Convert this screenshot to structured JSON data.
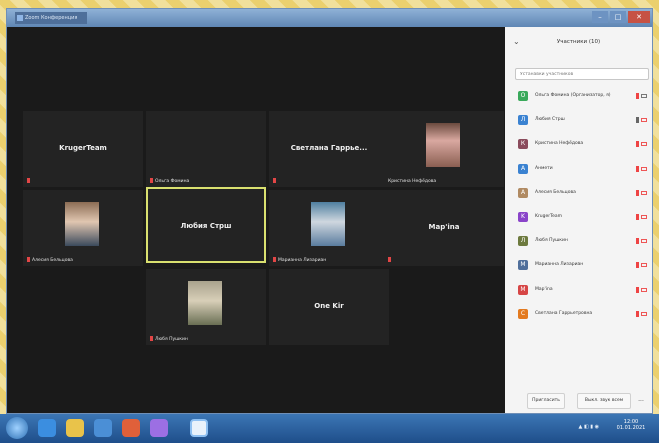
{
  "window": {
    "tab_title": "Zoom Конференция"
  },
  "gallery": {
    "tiles": [
      {
        "name": "KrugerTeam",
        "caption": ""
      },
      {
        "name": "",
        "caption": "Ольга Фомина"
      },
      {
        "name": "Светлана Гаррье...",
        "caption": ""
      },
      {
        "name": "",
        "caption": "Кристина Нефёдова"
      },
      {
        "name": "",
        "caption": "Алесия Бельцова"
      },
      {
        "name": "Любия Стрш",
        "caption": ""
      },
      {
        "name": "",
        "caption": "Марианна Лизариан"
      },
      {
        "name": "Мар'inа",
        "caption": ""
      },
      {
        "name": "",
        "caption": "Любя Пушкин"
      },
      {
        "name": "One Kir",
        "caption": ""
      }
    ]
  },
  "panel": {
    "title": "Участники (10)",
    "search_placeholder": "Устанавки участников",
    "participants": [
      {
        "name": "Ольга Фомина (Организатор, я)",
        "color": "#3aa95b",
        "initial": "O"
      },
      {
        "name": "Любия Стрш",
        "color": "#3a82d1",
        "initial": "Л"
      },
      {
        "name": "Кристина Нефёдова",
        "color": "#8a4b5c",
        "initial": "К"
      },
      {
        "name": "Анмети",
        "color": "#3a82d1",
        "initial": "A"
      },
      {
        "name": "Алесия Бельцова",
        "color": "#b08a62",
        "initial": "A"
      },
      {
        "name": "KrugerTeam",
        "color": "#8a44c9",
        "initial": "K"
      },
      {
        "name": "Любя Пушкин",
        "color": "#6d7a3e",
        "initial": "Л"
      },
      {
        "name": "Марианна Лизариан",
        "color": "#506f9b",
        "initial": "M"
      },
      {
        "name": "Мар'inа",
        "color": "#d64545",
        "initial": "M"
      },
      {
        "name": "Светлана Гаррьетровна",
        "color": "#e37a1f",
        "initial": "С"
      }
    ],
    "invite_label": "Пригласить",
    "mute_all_label": "Выкл. звук всем",
    "more_label": "..."
  },
  "taskbar": {
    "clock_time": "12:00",
    "clock_date": "01.01.2021"
  }
}
